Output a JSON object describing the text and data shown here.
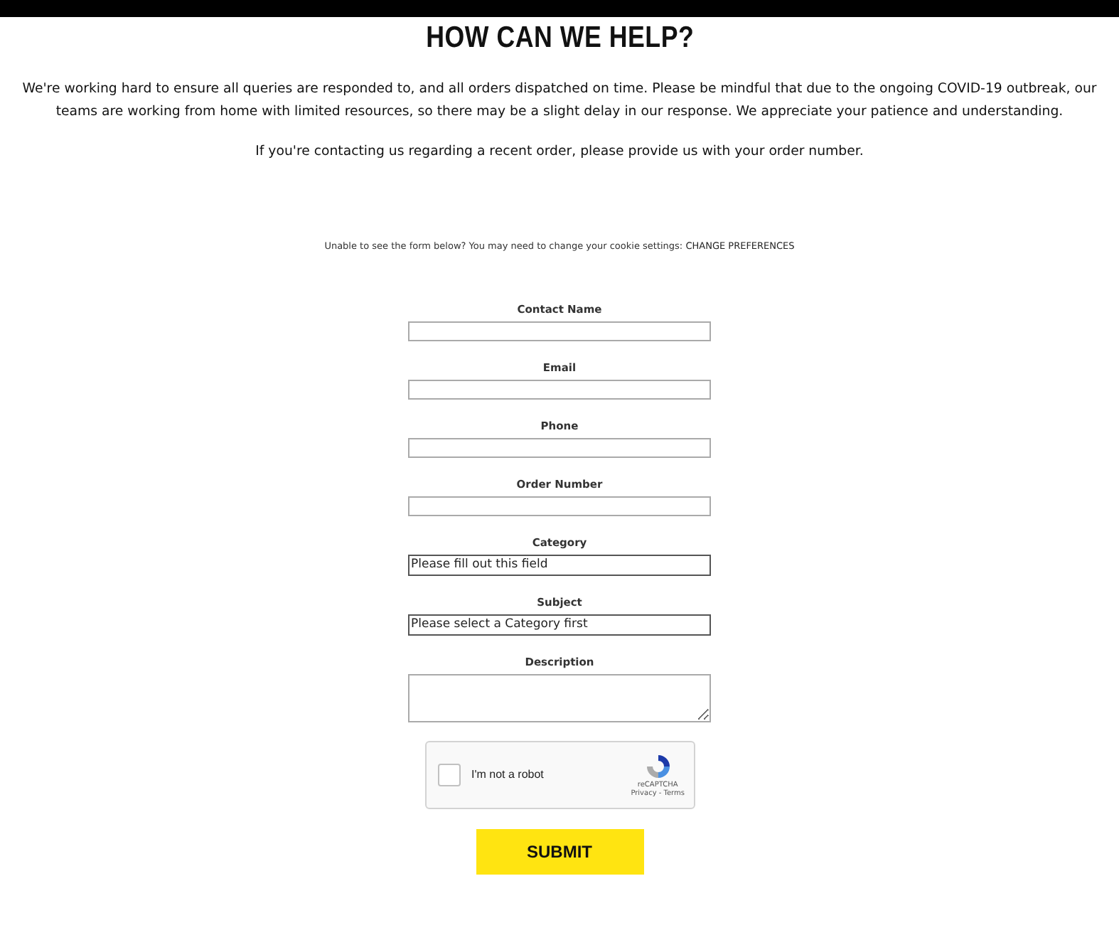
{
  "heading": "HOW CAN WE HELP?",
  "intro": [
    "We're working hard to ensure all queries are responded to, and all orders dispatched on time. Please be mindful that due to the ongoing COVID-19 outbreak, our teams are working from home with limited resources, so there may be a slight delay in our response. We appreciate your patience and understanding.",
    "If you're contacting us regarding a recent order, please provide us with your order number."
  ],
  "cookie_notice": {
    "text": "Unable to see the form below? You may need to change your cookie settings:",
    "link": "CHANGE PREFERENCES"
  },
  "fields": [
    {
      "label": "Contact Name",
      "kind": "input"
    },
    {
      "label": "Email",
      "kind": "input"
    },
    {
      "label": "Phone",
      "kind": "input"
    },
    {
      "label": "Order Number",
      "kind": "input"
    },
    {
      "label": "Category",
      "kind": "select",
      "value": "Please fill out this field"
    },
    {
      "label": "Subject",
      "kind": "select",
      "value": "Please select a Category first"
    },
    {
      "label": "Description",
      "kind": "textarea"
    }
  ],
  "captcha": {
    "label": "I'm not a robot",
    "checked": false,
    "brand": "reCAPTCHA",
    "links": "Privacy - Terms"
  },
  "submit": "SUBMIT"
}
